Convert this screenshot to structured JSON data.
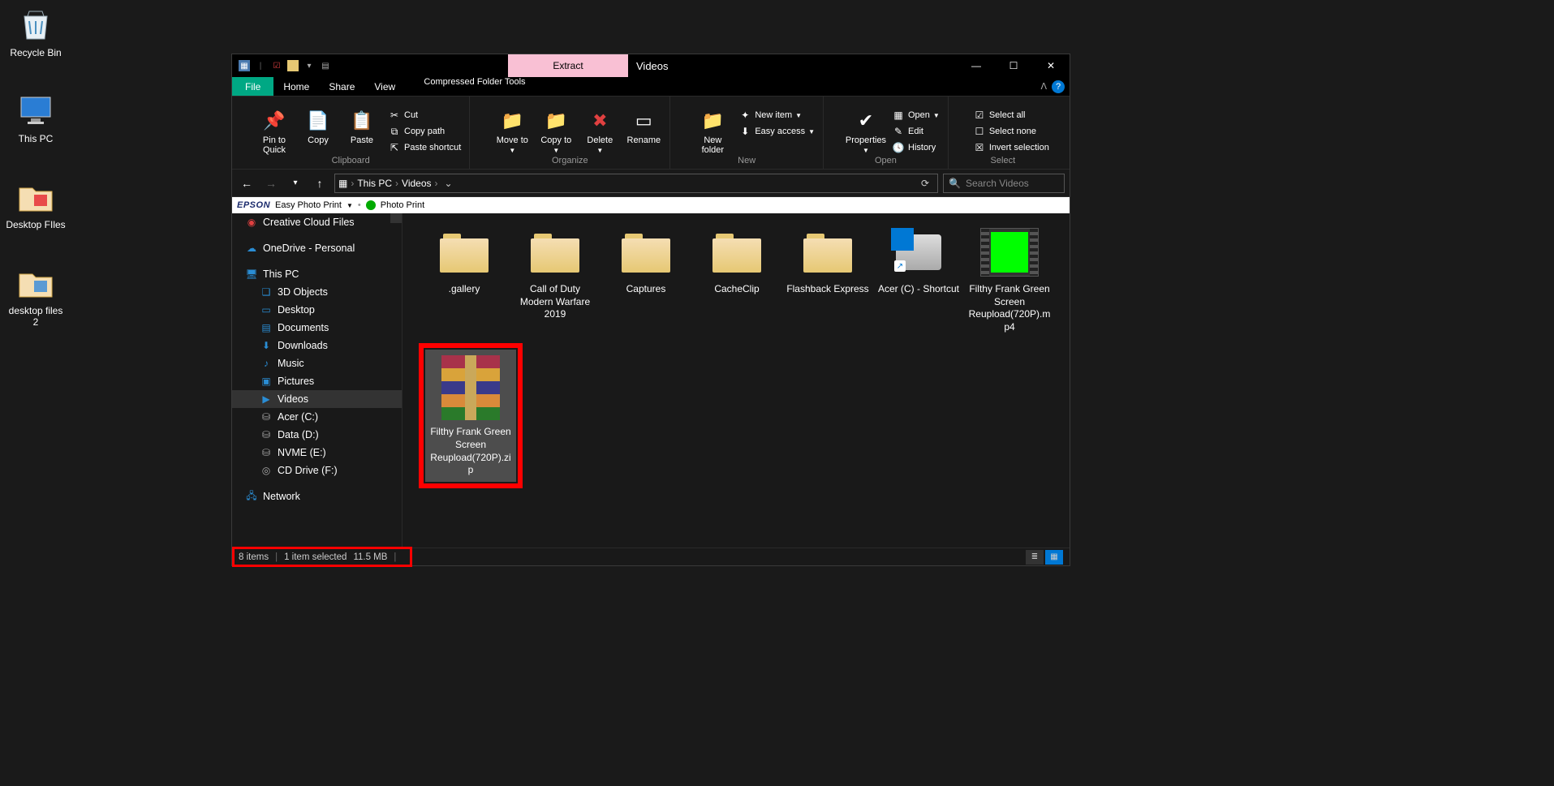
{
  "desktop": {
    "recycle_bin": "Recycle Bin",
    "this_pc": "This PC",
    "desktop_files": "Desktop FIles",
    "desktop_files_2": "desktop files 2"
  },
  "window": {
    "context_tab": "Extract",
    "context_group": "Compressed Folder Tools",
    "title": "Videos",
    "tabs": {
      "file": "File",
      "home": "Home",
      "share": "Share",
      "view": "View"
    }
  },
  "ribbon": {
    "clipboard": {
      "label": "Clipboard",
      "pin": "Pin to Quick access",
      "copy": "Copy",
      "paste": "Paste",
      "cut": "Cut",
      "copy_path": "Copy path",
      "paste_shortcut": "Paste shortcut"
    },
    "organize": {
      "label": "Organize",
      "move_to": "Move to",
      "copy_to": "Copy to",
      "delete": "Delete",
      "rename": "Rename"
    },
    "new": {
      "label": "New",
      "new_folder": "New folder",
      "new_item": "New item",
      "easy_access": "Easy access"
    },
    "open": {
      "label": "Open",
      "properties": "Properties",
      "open": "Open",
      "edit": "Edit",
      "history": "History"
    },
    "select": {
      "label": "Select",
      "select_all": "Select all",
      "select_none": "Select none",
      "invert": "Invert selection"
    }
  },
  "breadcrumb": {
    "root": "This PC",
    "current": "Videos"
  },
  "search_placeholder": "Search Videos",
  "epson": {
    "brand": "EPSON",
    "easy": "Easy Photo Print",
    "photo": "Photo Print"
  },
  "tree": {
    "creative_cloud": "Creative Cloud Files",
    "onedrive": "OneDrive - Personal",
    "this_pc": "This PC",
    "objects3d": "3D Objects",
    "desktop": "Desktop",
    "documents": "Documents",
    "downloads": "Downloads",
    "music": "Music",
    "pictures": "Pictures",
    "videos": "Videos",
    "acer_c": "Acer (C:)",
    "data_d": "Data (D:)",
    "nvme_e": "NVME (E:)",
    "cd_f": "CD Drive (F:)",
    "network": "Network"
  },
  "files": {
    "gallery": ".gallery",
    "cod": "Call of Duty Modern Warfare 2019",
    "captures": "Captures",
    "cacheclip": "CacheClip",
    "flashback": "Flashback Express",
    "acer_shortcut": "Acer (C) - Shortcut",
    "video1": "Filthy Frank Green Screen Reupload(720P).mp4",
    "zip1": "Filthy Frank Green Screen Reupload(720P).zip"
  },
  "status": {
    "count": "8 items",
    "selection": "1 item selected",
    "size": "11.5 MB"
  }
}
